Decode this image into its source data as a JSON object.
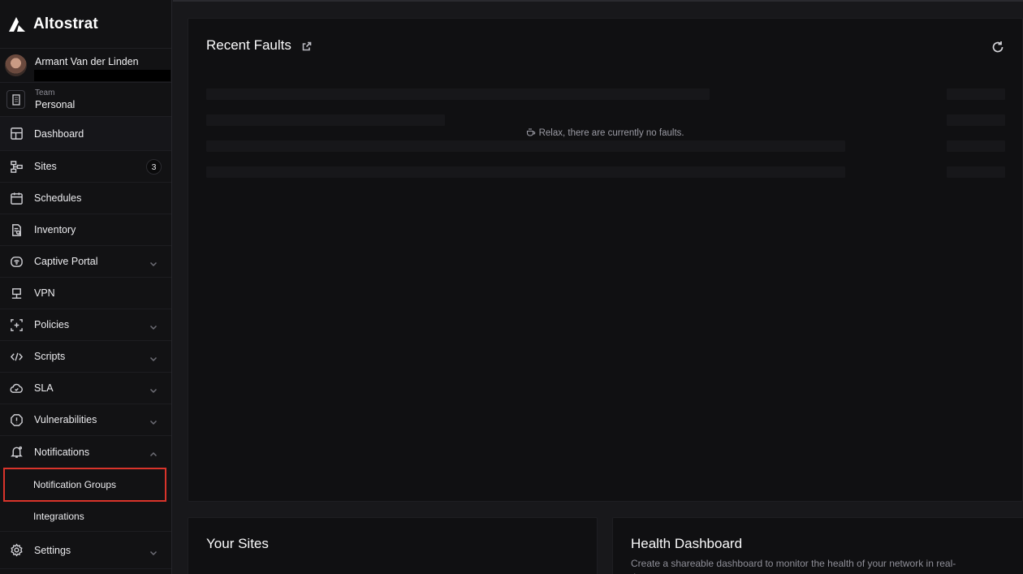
{
  "brand": {
    "name": "Altostrat"
  },
  "user": {
    "name": "Armant Van der Linden"
  },
  "team": {
    "caption": "Team",
    "value": "Personal"
  },
  "nav": {
    "dashboard": "Dashboard",
    "sites": "Sites",
    "sites_count": "3",
    "schedules": "Schedules",
    "inventory": "Inventory",
    "captive_portal": "Captive Portal",
    "vpn": "VPN",
    "policies": "Policies",
    "scripts": "Scripts",
    "sla": "SLA",
    "vulnerabilities": "Vulnerabilities",
    "notifications": "Notifications",
    "notification_groups": "Notification Groups",
    "integrations": "Integrations",
    "settings": "Settings"
  },
  "faults": {
    "title": "Recent Faults",
    "empty_message": "Relax, there are currently no faults."
  },
  "sites_card": {
    "title": "Your Sites"
  },
  "health": {
    "title": "Health Dashboard",
    "description": "Create a shareable dashboard to monitor the health of your network in real-time"
  },
  "colors": {
    "highlight": "#d9342b",
    "background": "#18181b",
    "sidebar": "#121214"
  }
}
